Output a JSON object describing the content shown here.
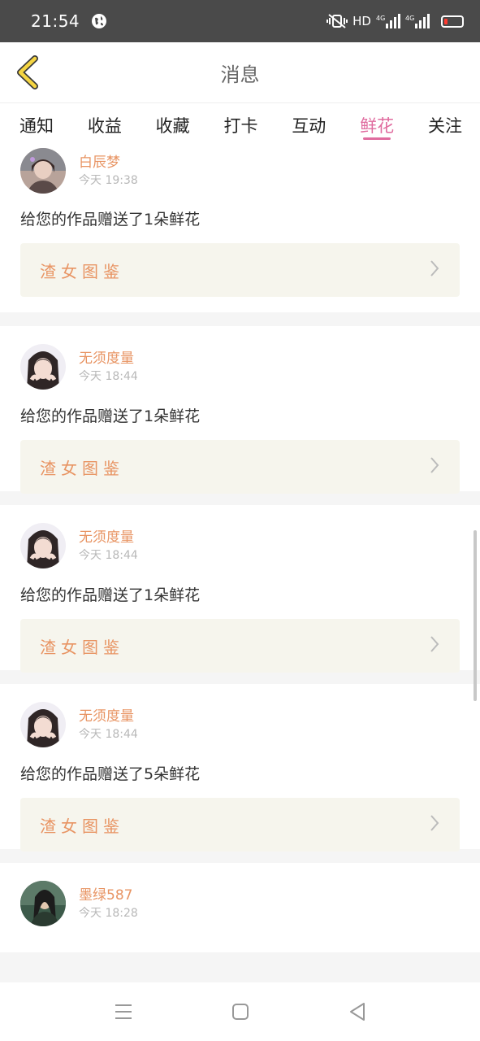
{
  "status_bar": {
    "time": "21:54",
    "network_label": "HD",
    "sig1_label": "4G",
    "sig2_label": "4G"
  },
  "header": {
    "title": "消息"
  },
  "tabs": [
    {
      "label": "通知",
      "active": false
    },
    {
      "label": "收益",
      "active": false
    },
    {
      "label": "收藏",
      "active": false
    },
    {
      "label": "打卡",
      "active": false
    },
    {
      "label": "互动",
      "active": false
    },
    {
      "label": "鲜花",
      "active": true
    },
    {
      "label": "关注",
      "active": false
    }
  ],
  "messages": [
    {
      "user": "白辰梦",
      "time": "今天 19:38",
      "text": "给您的作品赠送了1朵鲜花",
      "work": "渣女图鉴"
    },
    {
      "user": "无须度量",
      "time": "今天 18:44",
      "text": "给您的作品赠送了1朵鲜花",
      "work": "渣女图鉴"
    },
    {
      "user": "无须度量",
      "time": "今天 18:44",
      "text": "给您的作品赠送了1朵鲜花",
      "work": "渣女图鉴"
    },
    {
      "user": "无须度量",
      "time": "今天 18:44",
      "text": "给您的作品赠送了5朵鲜花",
      "work": "渣女图鉴"
    },
    {
      "user": "墨绿587",
      "time": "今天 18:28"
    }
  ],
  "colors": {
    "accent_pink": "#e06c9f",
    "username_orange": "#e89463",
    "work_box_bg": "#f6f5ed",
    "back_arrow_yellow": "#f5d542"
  }
}
